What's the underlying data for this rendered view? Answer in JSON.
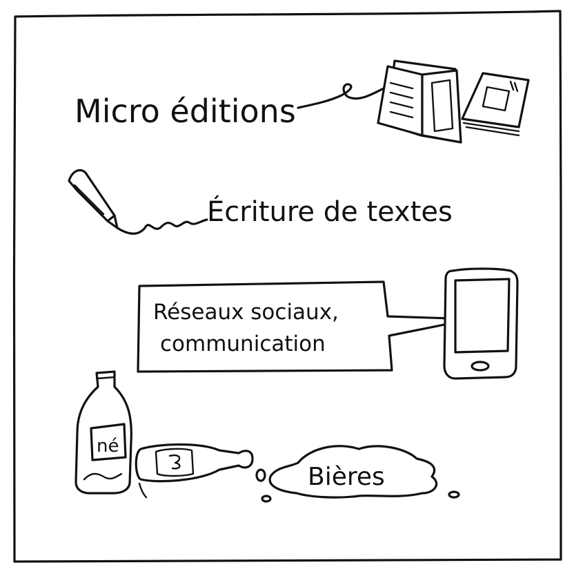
{
  "labels": {
    "micro_editions": "Micro éditions",
    "ecriture": "Écriture de textes",
    "reseaux_line1": "Réseaux sociaux,",
    "reseaux_line2": "communication",
    "bieres": "Bières",
    "bottle_label": "né"
  },
  "icons": [
    "booklet-icon",
    "pen-icon",
    "smartphone-icon",
    "beer-bottle-icon",
    "beer-puddle-icon"
  ],
  "colors": {
    "ink": "#111111",
    "paper": "#ffffff"
  }
}
